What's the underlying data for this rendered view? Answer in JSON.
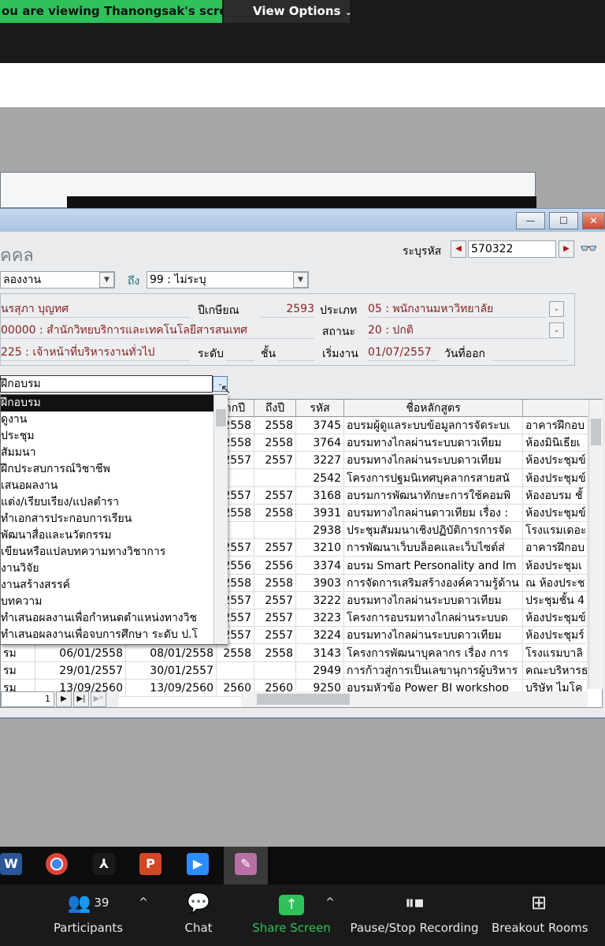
{
  "zoom": {
    "viewing_label": "ou are viewing Thanongsak's screen",
    "view_options_label": "View Options",
    "participants_count": "39",
    "participants_label": "Participants",
    "chat_label": "Chat",
    "share_label": "Share Screen",
    "record_label": "Pause/Stop Recording",
    "breakout_label": "Breakout Rooms"
  },
  "window": {
    "title_fragment": "คคล",
    "min_label": "—",
    "max_label": "☐",
    "close_label": "✕"
  },
  "form": {
    "code_label": "ระบุรหัส",
    "code_value": "570322",
    "type_from_value": "ลองงาน",
    "to_label": "ถึง",
    "type_to_value": "99 : ไม่ระบุ",
    "name_value": "นรสุภา บุญทศ",
    "retire_year_label": "ปีเกษียณ",
    "retire_year_value": "2593",
    "category_label": "ประเภท",
    "category_value": "05 : พนักงานมหาวิทยาลัย",
    "unit_value": "00000 : สำนักวิทยบริการและเทคโนโลยีสารสนเทศ",
    "status_label": "สถานะ",
    "status_value": "20 : ปกติ",
    "position_value": "225 : เจ้าหน้าที่บริหารงานทั่วไป",
    "level_label": "ระดับ",
    "step_label": "ชั้น",
    "start_label": "เริ่มงาน",
    "start_value": "01/07/2557",
    "leave_label": "วันที่ออก",
    "training_combo_value": "ฝึกอบรม"
  },
  "dropdown": {
    "items": [
      "ฝึกอบรม",
      "ดูงาน",
      "ประชุม",
      "สัมมนา",
      "ฝึกประสบการณ์วิชาชีพ",
      "เสนอผลงาน",
      "แต่ง/เรียบเรียง/แปลตำรา",
      "ทำเอกสารประกอบการเรียน",
      "พัฒนาสื่อและนวัตกรรม",
      "เขียนหรือแปลบทความทางวิชาการ",
      "งานวิจัย",
      "งานสร้างสรรค์",
      "บทความ",
      "ทำเสนอผลงานเพื่อกำหนดตำแหน่งทางวิช",
      "ทำเสนอผลงานเพื่อจบการศึกษา ระดับ ป.โ"
    ]
  },
  "grid": {
    "headers": [
      "ากปี",
      "ถึงปี",
      "รหัส",
      "ชื่อหลักสูตร",
      ""
    ],
    "rows": [
      {
        "c0": "",
        "c1": "",
        "c2": "",
        "y1": "2558",
        "y2": "2558",
        "code": "3745",
        "course": "อบรมผู้ดูแลระบบข้อมูลการจัดระบเ",
        "place": "อาคารฝึกอบ"
      },
      {
        "c0": "",
        "c1": "",
        "c2": "",
        "y1": "2558",
        "y2": "2558",
        "code": "3764",
        "course": "อบรมทางไกลผ่านระบบดาวเทียม",
        "place": "ห้องมินิเธียเ"
      },
      {
        "c0": "",
        "c1": "",
        "c2": "",
        "y1": "2557",
        "y2": "2557",
        "code": "3227",
        "course": "อบรมทางไกลผ่านระบบดาวเทียม",
        "place": "ห้องประชุมข์"
      },
      {
        "c0": "",
        "c1": "",
        "c2": "",
        "y1": "",
        "y2": "",
        "code": "2542",
        "course": "โครงการปฐมนิเทศบุคลากรสายสนั",
        "place": "ห้องประชุมข์"
      },
      {
        "c0": "",
        "c1": "",
        "c2": "",
        "y1": "2557",
        "y2": "2557",
        "code": "3168",
        "course": "อบรมการพัฒนาทักษะการใช้คอมพิ",
        "place": "ห้องอบรม ชั้"
      },
      {
        "c0": "",
        "c1": "",
        "c2": "",
        "y1": "2558",
        "y2": "2558",
        "code": "3931",
        "course": "อบรมทางไกลผ่านดาวเทียม เรื่อง :",
        "place": "ห้องประชุมข์"
      },
      {
        "c0": "",
        "c1": "",
        "c2": "",
        "y1": "",
        "y2": "",
        "code": "2938",
        "course": "ประชุมสัมมนาเชิงปฏิบัติการการจัด",
        "place": "โรงแรมเดอะ"
      },
      {
        "c0": "",
        "c1": "",
        "c2": "",
        "y1": "2557",
        "y2": "2557",
        "code": "3210",
        "course": "การพัฒนาเว็บบล็อคและเว็บไซต์ส่",
        "place": "อาคารฝึกอบ"
      },
      {
        "c0": "",
        "c1": "",
        "c2": "",
        "y1": "2556",
        "y2": "2556",
        "code": "3374",
        "course": "อบรม Smart Personality and Im",
        "place": "ห้องประชุมเ"
      },
      {
        "c0": "",
        "c1": "",
        "c2": "",
        "y1": "2558",
        "y2": "2558",
        "code": "3903",
        "course": "การจัดการเสริมสร้างองค์ความรู้ด้าน",
        "place": "ณ ห้องประช"
      },
      {
        "c0": "",
        "c1": "",
        "c2": "",
        "y1": "2557",
        "y2": "2557",
        "code": "3222",
        "course": "อบรมทางไกลผ่านระบบดาวเทียม",
        "place": "ประชุมชั้น 4"
      },
      {
        "c0": "",
        "c1": "",
        "c2": "",
        "y1": "2557",
        "y2": "2557",
        "code": "3223",
        "course": "โครงการอบรมทางไกลผ่านระบบด",
        "place": "ห้องประชุมข์"
      },
      {
        "c0": "",
        "c1": "",
        "c2": "",
        "y1": "2557",
        "y2": "2557",
        "code": "3224",
        "course": "อบรมทางไกลผ่านระบบดาวเทียม",
        "place": "ห้องประชุมร์"
      },
      {
        "c0": "รม",
        "c1": "06/01/2558",
        "c2": "08/01/2558",
        "y1": "2558",
        "y2": "2558",
        "code": "3143",
        "course": "โครงการพัฒนาบุคลากร เรื่อง การ",
        "place": "โรงแรมบาลิ"
      },
      {
        "c0": "รม",
        "c1": "29/01/2557",
        "c2": "30/01/2557",
        "y1": "",
        "y2": "",
        "code": "2949",
        "course": "การก้าวสู่การเป็นเลขานุการผู้บริหาร",
        "place": "คณะบริหารธ"
      },
      {
        "c0": "รม",
        "c1": "13/09/2560",
        "c2": "13/09/2560",
        "y1": "2560",
        "y2": "2560",
        "code": "9250",
        "course": "อบรมหัวข้อ Power BI workshop",
        "place": "บริษัท ไมโค"
      }
    ],
    "record_number": "1"
  },
  "taskbar": {
    "apps": [
      "word-icon",
      "chrome-icon",
      "acrobat-icon",
      "powerpoint-icon",
      "zoom-icon",
      "app-icon"
    ]
  },
  "colors": {
    "zoom_green": "#2fc25b",
    "field_red": "#8a2020",
    "title_blue": "#a9c3df"
  }
}
